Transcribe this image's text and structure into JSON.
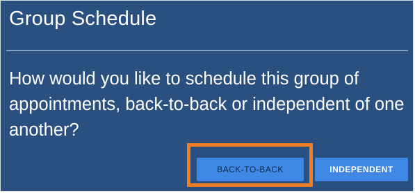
{
  "dialog": {
    "title": "Group Schedule",
    "message": "How would you like to schedule this group of appointments, back-to-back or independent of one another?",
    "buttons": {
      "back_to_back": "BACK-TO-BACK",
      "independent": "INDEPENDENT"
    }
  },
  "colors": {
    "dialog_background": "#2a5080",
    "button_background": "#3f88e6",
    "highlight_border": "#f07e23"
  }
}
